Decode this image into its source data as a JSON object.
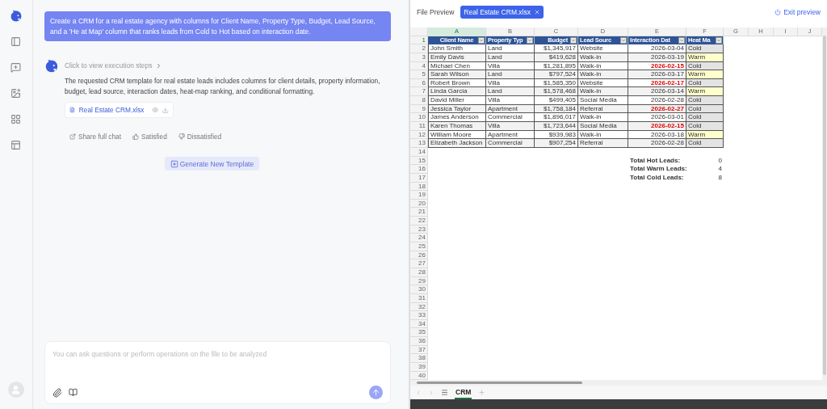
{
  "chat": {
    "user_message": "Create a CRM for a real estate agency with columns for Client Name, Property Type, Budget, Lead Source, and a 'He at Map' column that ranks leads from Cold to Hot based on interaction date.",
    "execution_steps": "Click to view execution steps",
    "reply": "The requested CRM template for real estate leads includes columns for client details, property information, budget, lead source, interaction dates, heat-map ranking, and conditional formatting.",
    "attachment": "Real Estate CRM.xlsx",
    "actions": [
      "Share full chat",
      "Satisfied",
      "Dissatisfied"
    ],
    "generate_button": "Generate New Template",
    "input": {
      "placeholder": "You can ask questions or perform operations on the file to be analyzed"
    }
  },
  "preview": {
    "title": "File Preview",
    "file_tab": "Real Estate CRM.xlsx",
    "exit": "Exit preview",
    "columns": [
      {
        "label": "A",
        "selected": true
      },
      {
        "label": "B",
        "selected": false
      },
      {
        "label": "C",
        "selected": false
      },
      {
        "label": "D",
        "selected": false
      },
      {
        "label": "E",
        "selected": false
      },
      {
        "label": "F",
        "selected": false
      },
      {
        "label": "G",
        "selected": false
      },
      {
        "label": "H",
        "selected": false
      },
      {
        "label": "I",
        "selected": false
      },
      {
        "label": "J",
        "selected": false
      }
    ],
    "headers": [
      "Client Name",
      "Property Typ",
      "Budget",
      "Lead Sourc",
      "Interaction Dat",
      "Heat Ma"
    ],
    "rows": [
      {
        "name": "John Smith",
        "type": "Land",
        "budget": "$1,345,917",
        "source": "Website",
        "date": "2026-03-04",
        "overdue": false,
        "heat": "Cold",
        "color": "#e3e3e3"
      },
      {
        "name": "Emily Davis",
        "type": "Land",
        "budget": "$419,628",
        "source": "Walk-in",
        "date": "2026-03-19",
        "overdue": false,
        "heat": "Warm",
        "color": "#ffffcc"
      },
      {
        "name": "Michael Chen",
        "type": "Villa",
        "budget": "$1,281,895",
        "source": "Walk-in",
        "date": "2026-02-15",
        "overdue": true,
        "heat": "Cold",
        "color": "#e3e3e3"
      },
      {
        "name": "Sarah Wilson",
        "type": "Land",
        "budget": "$797,524",
        "source": "Walk-in",
        "date": "2026-03-17",
        "overdue": false,
        "heat": "Warm",
        "color": "#ffffcc"
      },
      {
        "name": "Robert Brown",
        "type": "Villa",
        "budget": "$1,585,350",
        "source": "Website",
        "date": "2026-02-17",
        "overdue": true,
        "heat": "Cold",
        "color": "#e3e3e3"
      },
      {
        "name": "Linda Garcia",
        "type": "Land",
        "budget": "$1,578,468",
        "source": "Walk-in",
        "date": "2026-03-14",
        "overdue": false,
        "heat": "Warm",
        "color": "#ffffcc"
      },
      {
        "name": "David Miller",
        "type": "Villa",
        "budget": "$499,405",
        "source": "Social Media",
        "date": "2026-02-28",
        "overdue": false,
        "heat": "Cold",
        "color": "#e3e3e3"
      },
      {
        "name": "Jessica Taylor",
        "type": "Apartment",
        "budget": "$1,758,184",
        "source": "Referral",
        "date": "2026-02-27",
        "overdue": true,
        "heat": "Cold",
        "color": "#e3e3e3"
      },
      {
        "name": "James Anderson",
        "type": "Commercial",
        "budget": "$1,896,017",
        "source": "Walk-in",
        "date": "2026-03-01",
        "overdue": false,
        "heat": "Cold",
        "color": "#e3e3e3"
      },
      {
        "name": "Karen Thomas",
        "type": "Villa",
        "budget": "$1,723,644",
        "source": "Social Media",
        "date": "2026-02-15",
        "overdue": true,
        "heat": "Cold",
        "color": "#e3e3e3"
      },
      {
        "name": "William Moore",
        "type": "Apartment",
        "budget": "$939,983",
        "source": "Walk-in",
        "date": "2026-03-18",
        "overdue": false,
        "heat": "Warm",
        "color": "#ffffcc"
      },
      {
        "name": "Elizabeth Jackson",
        "type": "Commercial",
        "budget": "$907,254",
        "source": "Referral",
        "date": "2026-02-28",
        "overdue": false,
        "heat": "Cold",
        "color": "#e3e3e3"
      }
    ],
    "totals": [
      {
        "label": "Total Hot Leads:",
        "value": "0"
      },
      {
        "label": "Total Warm Leads:",
        "value": "4"
      },
      {
        "label": "Total Cold Leads:",
        "value": "8"
      }
    ],
    "row_numbers": [
      "1",
      "2",
      "3",
      "4",
      "5",
      "6",
      "7",
      "8",
      "9",
      "10",
      "11",
      "12",
      "13",
      "14",
      "15",
      "16",
      "17",
      "18",
      "19",
      "20",
      "21",
      "22",
      "23",
      "24",
      "25",
      "26",
      "27",
      "28",
      "29",
      "30",
      "31",
      "32",
      "33",
      "34",
      "35",
      "36",
      "37",
      "38",
      "39",
      "40"
    ],
    "sheets": [
      {
        "label": "CRM",
        "selected": true
      }
    ]
  }
}
